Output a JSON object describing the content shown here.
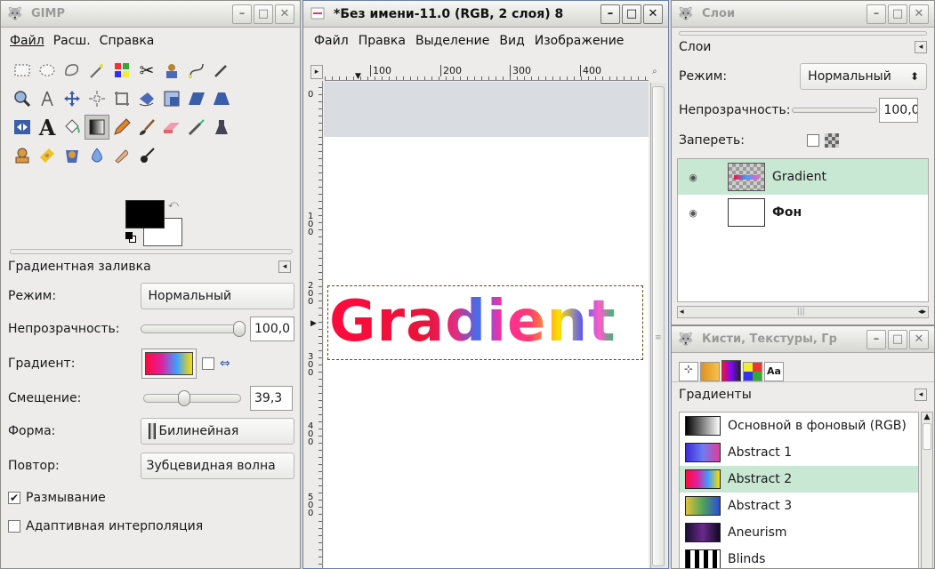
{
  "toolbox": {
    "title": "GIMP",
    "menu": [
      "Файл",
      "Расш.",
      "Справка"
    ],
    "tools_row1": [
      "rect-select-icon",
      "ellipse-select-icon",
      "free-select-icon",
      "fuzzy-select-icon",
      "color-select-icon",
      "scissors-icon",
      "foreground-select-icon",
      "paths-icon",
      "color-picker-icon"
    ],
    "tools_row2": [
      "zoom-icon",
      "measure-icon",
      "move-icon",
      "align-icon",
      "crop-icon",
      "rotate-icon",
      "scale-icon",
      "shear-icon",
      "perspective-icon"
    ],
    "tools_row3": [
      "flip-icon",
      "text-icon",
      "bucket-fill-icon",
      "blend-icon",
      "pencil-icon",
      "paintbrush-icon",
      "eraser-icon",
      "airbrush-icon",
      "ink-icon"
    ],
    "tools_row4": [
      "clone-icon",
      "heal-icon",
      "perspective-clone-icon",
      "blur-icon",
      "smudge-icon",
      "dodge-burn-icon"
    ],
    "fg_color": "#000000",
    "bg_color": "#ffffff",
    "options": {
      "title": "Градиентная заливка",
      "mode_label": "Режим:",
      "mode_value": "Нормальный",
      "opacity_label": "Непрозрачность:",
      "opacity_value": "100,0",
      "opacity_fraction": 1.0,
      "gradient_label": "Градиент:",
      "offset_label": "Смещение:",
      "offset_value": "39,3",
      "offset_fraction": 0.393,
      "shape_label": "Форма:",
      "shape_value": "Билинейная",
      "repeat_label": "Повтор:",
      "repeat_value": "Зубцевидная волна",
      "dither_label": "Размывание",
      "dither_checked": true,
      "adaptive_label": "Адаптивная интерполяция",
      "adaptive_checked": false
    }
  },
  "image_window": {
    "title": "*Без имени-11.0 (RGB, 2 слоя) 8",
    "menu": [
      "Файл",
      "Правка",
      "Выделение",
      "Вид",
      "Изображение"
    ],
    "ruler_top": [
      "100",
      "200",
      "300",
      "400"
    ],
    "ruler_left": [
      "0",
      "100",
      "200",
      "300",
      "400",
      "500"
    ],
    "canvas_text": "Gradient"
  },
  "layers": {
    "title": "Слои",
    "tab_label": "Слои",
    "mode_label": "Режим:",
    "mode_value": "Нормальный",
    "opacity_label": "Непрозрачность:",
    "opacity_value": "100,0",
    "lock_label": "Запереть:",
    "items": [
      {
        "name": "Gradient",
        "selected": true
      },
      {
        "name": "Фон",
        "selected": false
      }
    ]
  },
  "brushes": {
    "title": "Кисти, Текстуры, Гр",
    "tab_label": "Градиенты",
    "gradients": [
      {
        "name": "Основной в фоновый (RGB)",
        "colors": [
          "#000000",
          "#ffffff"
        ],
        "selected": false
      },
      {
        "name": "Abstract 1",
        "colors": [
          "#3a2bd9",
          "#6f7cf0",
          "#e23c9a"
        ],
        "selected": false
      },
      {
        "name": "Abstract 2",
        "colors": [
          "#ff0a3c",
          "#e01fa0",
          "#3aa0ff",
          "#ffdd00"
        ],
        "selected": true
      },
      {
        "name": "Abstract 3",
        "colors": [
          "#e4c23a",
          "#4fa35b",
          "#2b4bd8"
        ],
        "selected": false
      },
      {
        "name": "Aneurism",
        "colors": [
          "#1a1030",
          "#6b2a8e",
          "#110820"
        ],
        "selected": false
      },
      {
        "name": "Blinds",
        "colors": [
          "#000000",
          "#ffffff",
          "#000000",
          "#ffffff"
        ],
        "selected": false
      }
    ]
  }
}
